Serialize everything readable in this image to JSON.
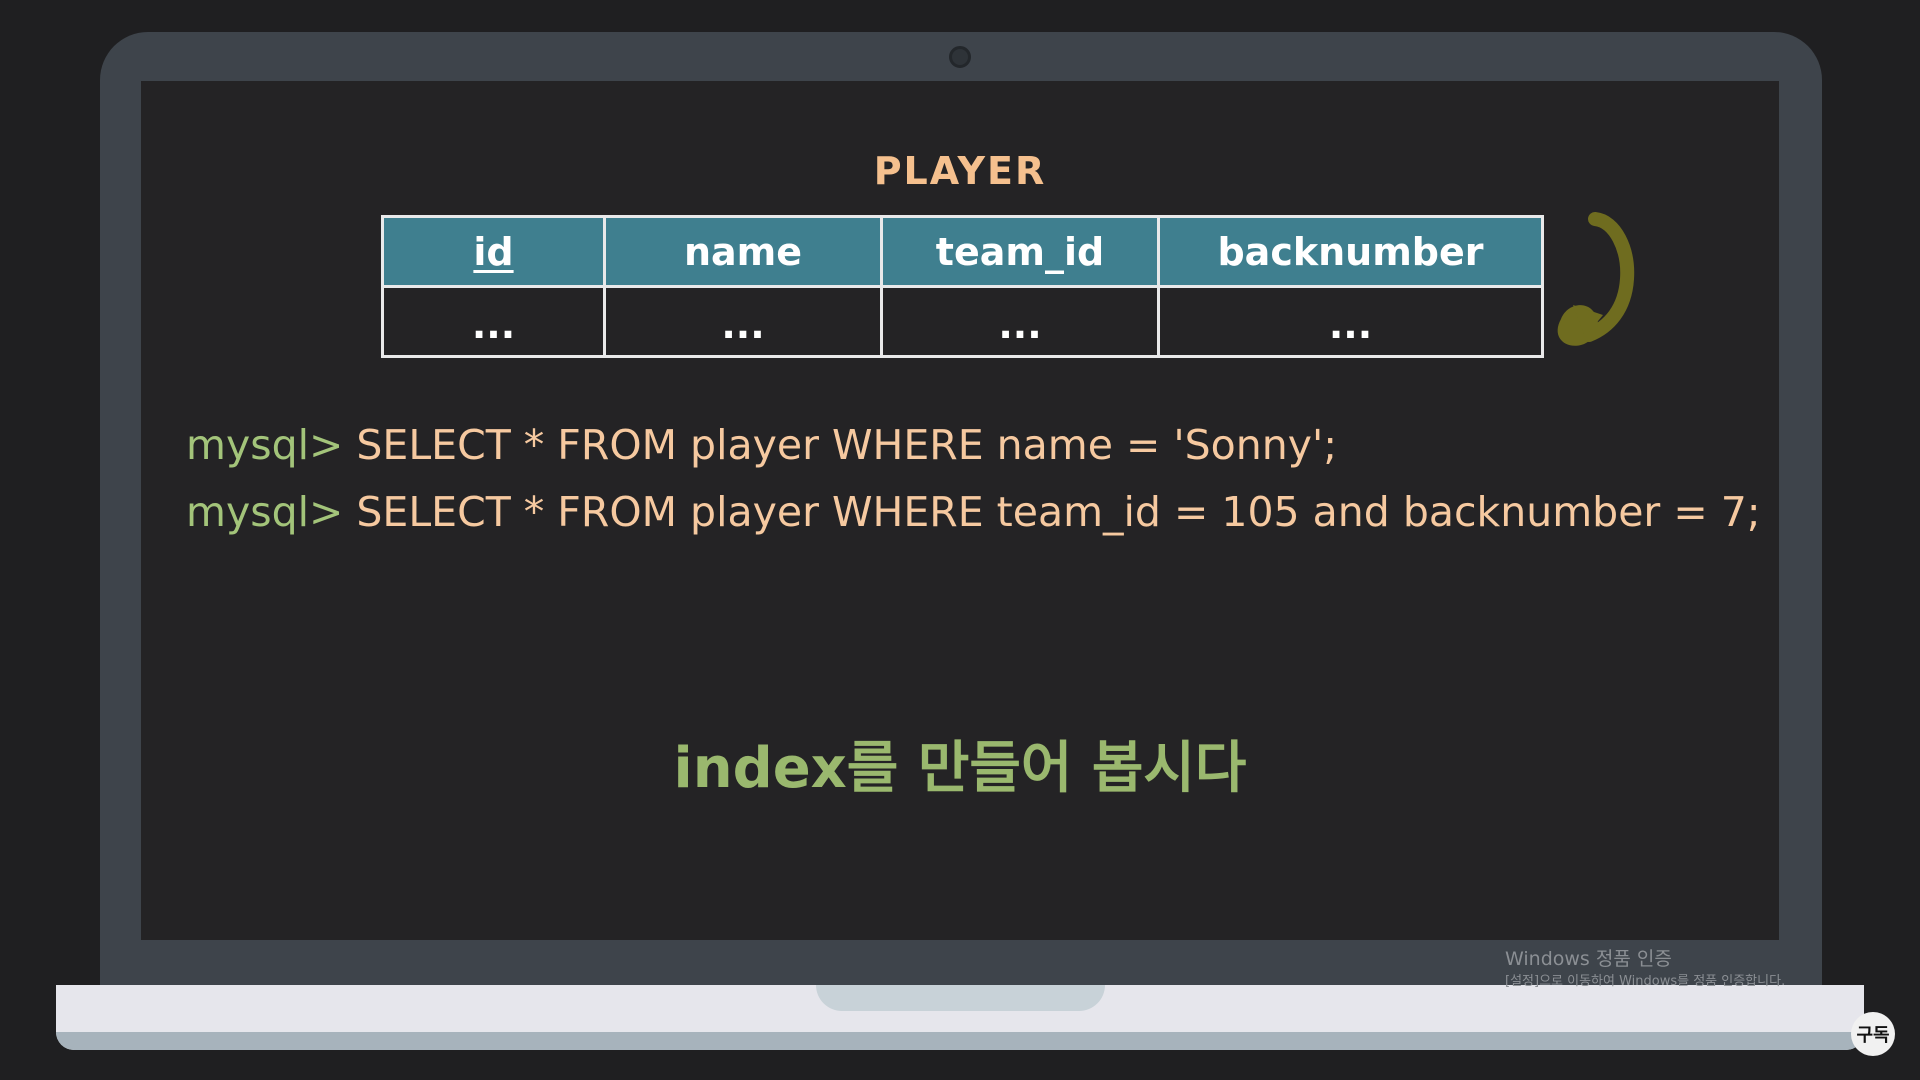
{
  "slide": {
    "table_title": "PLAYER",
    "columns": [
      "id",
      "name",
      "team_id",
      "backnumber"
    ],
    "row": [
      "...",
      "...",
      "...",
      "..."
    ],
    "queries": [
      {
        "prompt": "mysql>",
        "statement": "SELECT * FROM player WHERE name = 'Sonny';"
      },
      {
        "prompt": "mysql>",
        "statement": "SELECT * FROM player WHERE team_id = 105 and backnumber = 7;"
      }
    ],
    "caption": "index를 만들어 봅시다"
  },
  "overlay": {
    "activation_title": "Windows 정품 인증",
    "activation_subtitle": "[설정]으로 이동하여 Windows를 정품 인증합니다.",
    "subscribe_badge": "구독"
  },
  "colors": {
    "header_bg": "#3f7f8f",
    "title": "#f5c08e",
    "prompt": "#a3c47a",
    "statement": "#f6c9a0",
    "caption": "#9ab86e",
    "arrow": "#6f6c1f"
  },
  "icons": [
    "camera-icon",
    "curved-arrow-icon"
  ]
}
